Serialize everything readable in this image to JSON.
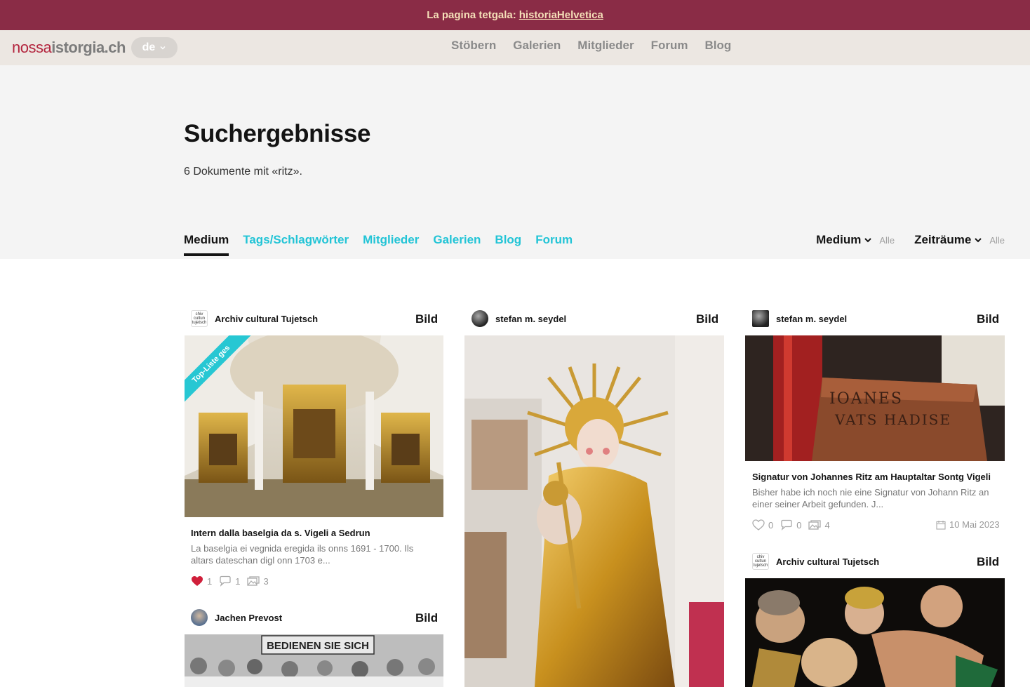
{
  "banner": {
    "prefix": "La pagina tetgala:",
    "link": "historiaHelvetica"
  },
  "header": {
    "logo_part1": "nossa",
    "logo_part2": "istorgia.ch",
    "lang": "de",
    "nav": [
      "Stöbern",
      "Galerien",
      "Mitglieder",
      "Forum",
      "Blog"
    ]
  },
  "hero": {
    "title": "Suchergebnisse",
    "count": "6 Dokumente mit «ritz»."
  },
  "tabs": [
    "Medium",
    "Tags/Schlagwörter",
    "Mitglieder",
    "Galerien",
    "Blog",
    "Forum"
  ],
  "filters": [
    {
      "label": "Medium",
      "value": "Alle"
    },
    {
      "label": "Zeiträume",
      "value": "Alle"
    }
  ],
  "cards": [
    {
      "author": "Archiv cultural Tujetsch",
      "avatar_text": "chiv cultun tujetsch",
      "type": "Bild",
      "ribbon": "Top-Liste ges",
      "title": "Intern dalla baselgia da s. Vigeli a Sedrun",
      "desc": "La baselgia ei vegnida eregida ils onns 1691 - 1700. Ils altars dateschan digl onn 1703 e...",
      "likes": "1",
      "comments": "1",
      "images": "3"
    },
    {
      "author": "Jachen Prevost",
      "type": "Bild",
      "image_text": "BEDIENEN SIE SICH"
    },
    {
      "author": "stefan m. seydel",
      "type": "Bild"
    },
    {
      "author": "stefan m. seydel",
      "type": "Bild",
      "image_text_1": "IOANES",
      "image_text_2": "VATS HADISE",
      "title": "Signatur von Johannes Ritz am Hauptaltar Sontg Vigeli",
      "desc": "Bisher habe ich noch nie eine Signatur von Johann Ritz an einer seiner Arbeit gefunden. J...",
      "likes": "0",
      "comments": "0",
      "images": "4",
      "date": "10 Mai 2023"
    },
    {
      "author": "Archiv cultural Tujetsch",
      "avatar_text": "chiv cultun tujetsch",
      "type": "Bild"
    }
  ],
  "colors": {
    "brand": "#8a2c46",
    "accent": "#22c4d6",
    "like": "#d01f3a"
  },
  "icons": [
    "chevron-down-icon",
    "heart-icon",
    "comment-icon",
    "gallery-icon",
    "calendar-icon"
  ]
}
